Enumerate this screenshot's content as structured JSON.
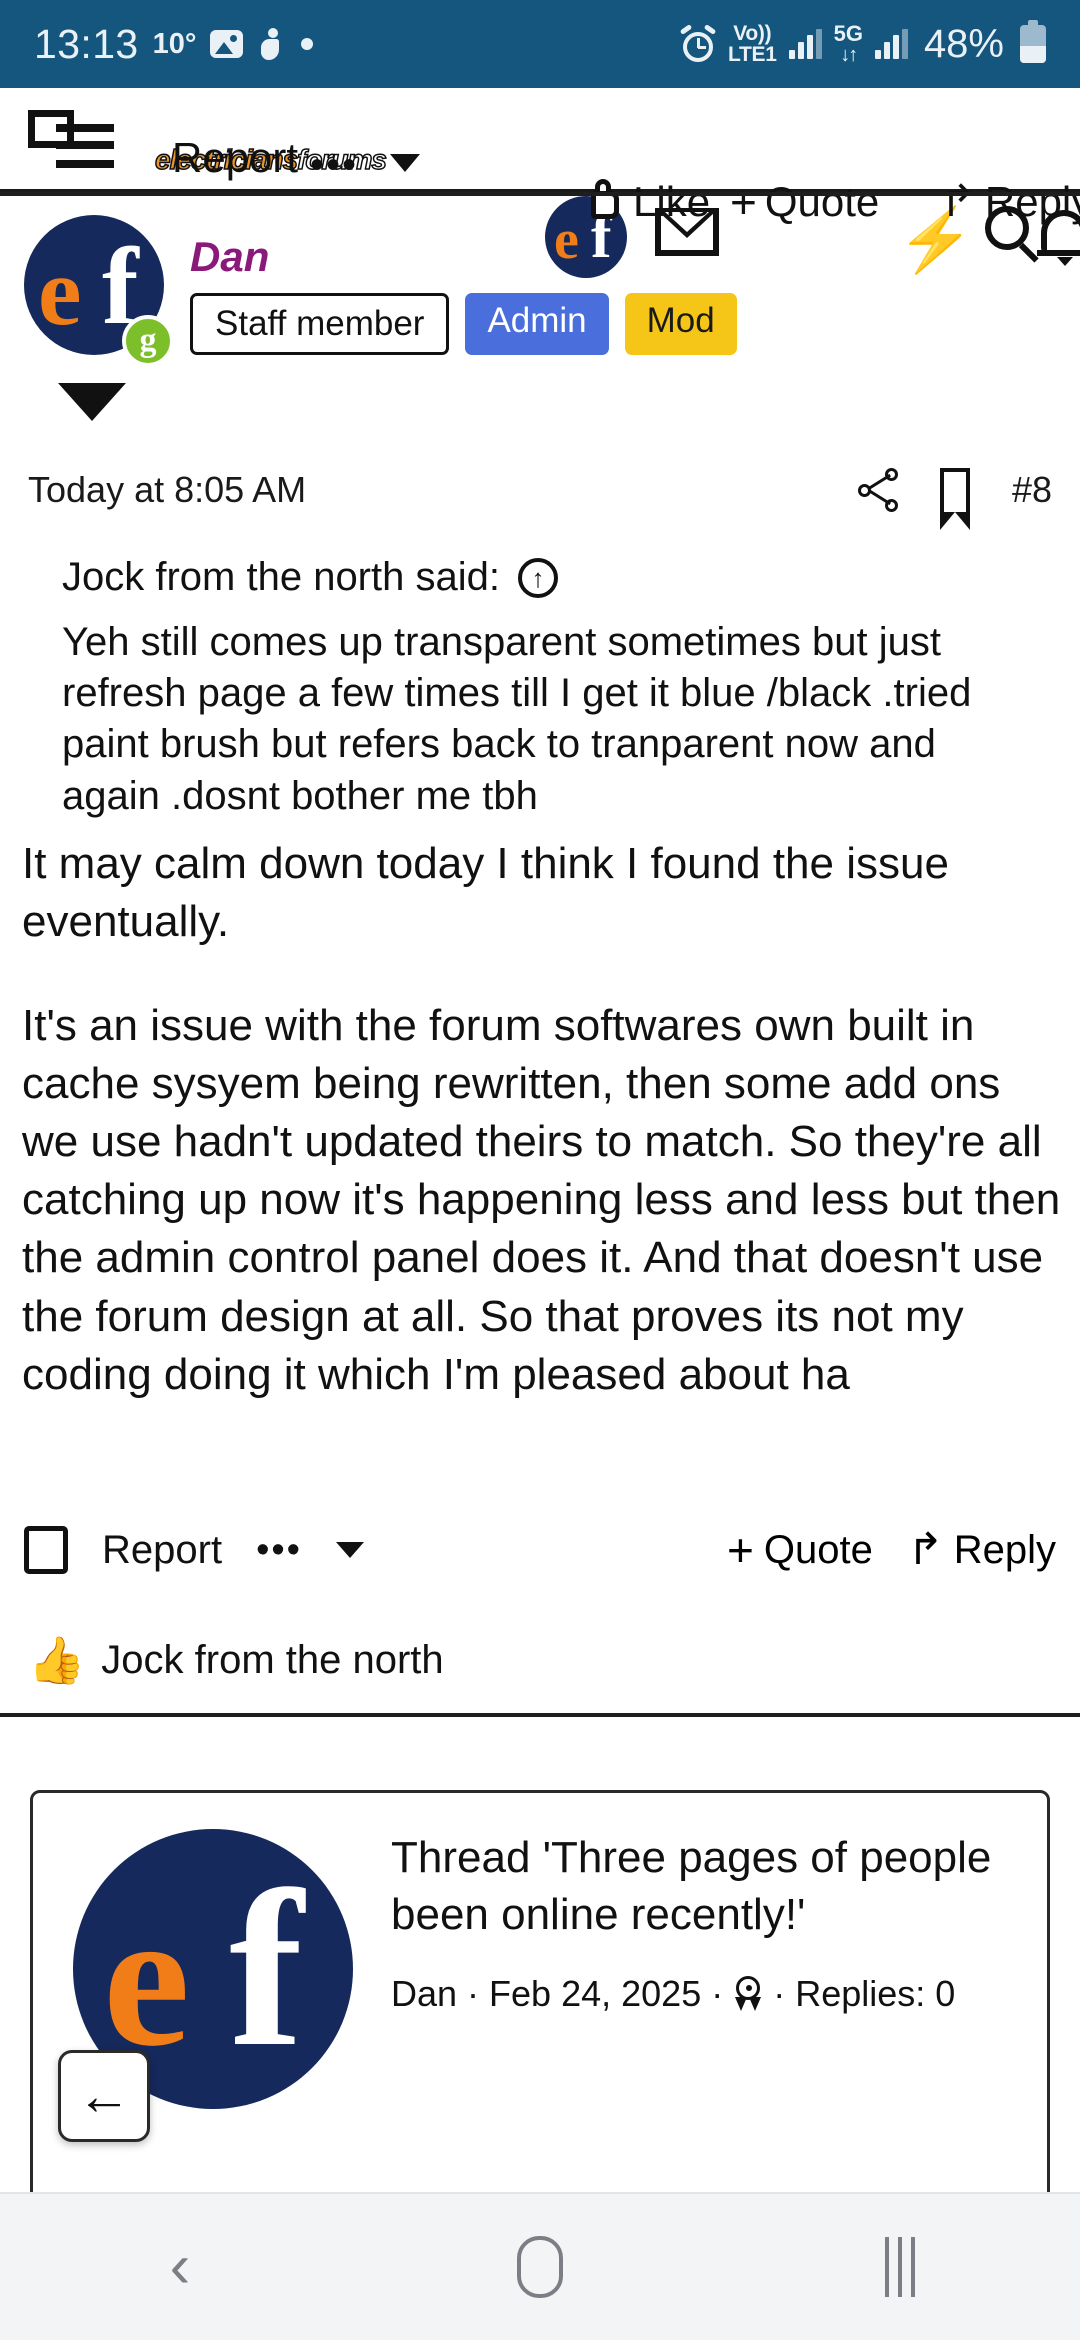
{
  "statusbar": {
    "time": "13:13",
    "temperature": "10°",
    "photo_icon": "photo-icon",
    "person_icon": "person-walking-icon",
    "dot_icon": "dot-indicator-icon",
    "alarm_icon": "alarm-clock-icon",
    "volte_line1": "Vo))",
    "volte_line2": "LTE1",
    "network_type": "5G",
    "data_arrows": "↓↑",
    "battery_percent": "48%",
    "bar_color": "#15567f"
  },
  "topnav": {
    "menu_icon": "hamburger-menu-icon",
    "site_logo_orange": "electricians",
    "site_logo_white": "forums",
    "ghost_report": "Report",
    "ghost_dots": "•••",
    "mail_icon": "mail-icon",
    "bell_icon": "bell-icon",
    "bolt_icon": "lightning-bolt-icon",
    "search_icon": "search-icon",
    "like_label": "Like",
    "quote_label": "Quote",
    "quote_plus": "+",
    "reply_label": "Reply"
  },
  "post": {
    "username": "Dan",
    "badges": [
      {
        "label": "Staff member",
        "style": "staff"
      },
      {
        "label": "Admin",
        "style": "admin"
      },
      {
        "label": "Mod",
        "style": "mod"
      }
    ],
    "online_badge_letter": "g",
    "date": "Today at 8:05 AM",
    "post_number": "#8",
    "share_icon": "share-icon",
    "bookmark_icon": "bookmark-icon",
    "quote_author_line": "Jock from the north said:",
    "quote_jump_icon": "↑",
    "quote_text": "Yeh still comes up transparent sometimes but just refresh page a few times till I get it blue /black .tried paint brush but refers back to tranparent now and again .dosnt bother me tbh",
    "paragraph_1": "It may calm down today I think I found the issue eventually.",
    "paragraph_2": "It's an issue with the forum softwares own built in cache sysyem being rewritten, then some add ons we use hadn't updated theirs to match. So they're all catching up now it's happening less and less but then the admin control panel does it. And that doesn't use the forum design at all. So that proves its not my coding doing it which I'm pleased about ha",
    "actions": {
      "report_label": "Report",
      "dots_label": "•••",
      "quote_label": "Quote",
      "quote_plus": "+",
      "reply_label": "Reply",
      "reply_icon": "reply-arrow-icon"
    },
    "reaction": {
      "emoji": "👍",
      "name": "Jock from the north"
    }
  },
  "thread_card": {
    "title": "Thread 'Three pages of people been online recently!'",
    "author": "Dan",
    "date": "Feb 24, 2025",
    "award_icon": "award-ribbon-icon",
    "replies": "Replies: 0",
    "separator": "·"
  },
  "back_fab": {
    "icon": "←"
  },
  "botnav": {
    "back_icon": "back-chevron-icon",
    "home_icon": "home-pill-icon",
    "recents_icon": "recents-bars-icon"
  }
}
